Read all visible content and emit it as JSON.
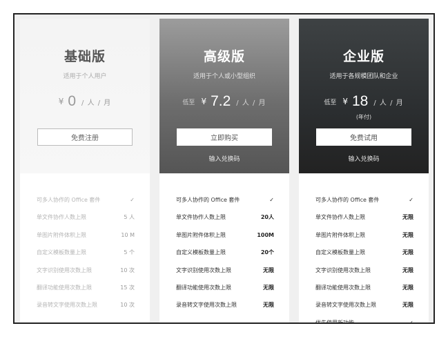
{
  "plans": [
    {
      "title": "基础版",
      "subtitle": "适用于个人用户",
      "price_prefix": "",
      "currency": "¥",
      "amount": "0",
      "unit": "/ 人 / 月",
      "note": "",
      "button": "免费注册",
      "redeem": "",
      "features": [
        {
          "label": "可多人协作的 Office 套件",
          "value": "✓"
        },
        {
          "label": "单文件协作人数上限",
          "value": "5 人"
        },
        {
          "label": "单图片附件体积上限",
          "value": "10 M"
        },
        {
          "label": "自定义模板数量上限",
          "value": "5 个"
        },
        {
          "label": "文字识别使用次数上限",
          "value": "10 次"
        },
        {
          "label": "翻译功能使用次数上限",
          "value": "15 次"
        },
        {
          "label": "录音转文字使用次数上限",
          "value": "10 次"
        }
      ]
    },
    {
      "title": "高级版",
      "subtitle": "适用于个人或小型组织",
      "price_prefix": "低至",
      "currency": "¥",
      "amount": "7.2",
      "unit": "/ 人 / 月",
      "note": "",
      "button": "立即购买",
      "redeem": "输入兑换码",
      "features": [
        {
          "label": "可多人协作的 Office 套件",
          "value": "✓"
        },
        {
          "label": "单文件协作人数上限",
          "value": "20人"
        },
        {
          "label": "单图片附件体积上限",
          "value": "100M"
        },
        {
          "label": "自定义模板数量上限",
          "value": "20个"
        },
        {
          "label": "文字识别使用次数上限",
          "value": "无限"
        },
        {
          "label": "翻译功能使用次数上限",
          "value": "无限"
        },
        {
          "label": "录音转文字使用次数上限",
          "value": "无限"
        }
      ]
    },
    {
      "title": "企业版",
      "subtitle": "适用于各规模团队和企业",
      "price_prefix": "低至",
      "currency": "¥",
      "amount": "18",
      "unit": "/ 人 / 月",
      "note": "(年付)",
      "button": "免费试用",
      "redeem": "输入兑换码",
      "features": [
        {
          "label": "可多人协作的 Office 套件",
          "value": "✓"
        },
        {
          "label": "单文件协作人数上限",
          "value": "无限"
        },
        {
          "label": "单图片附件体积上限",
          "value": "无限"
        },
        {
          "label": "自定义模板数量上限",
          "value": "无限"
        },
        {
          "label": "文字识别使用次数上限",
          "value": "无限"
        },
        {
          "label": "翻译功能使用次数上限",
          "value": "无限"
        },
        {
          "label": "录音转文字使用次数上限",
          "value": "无限"
        },
        {
          "label": "优先使用新功能",
          "value": "✓"
        }
      ]
    }
  ]
}
